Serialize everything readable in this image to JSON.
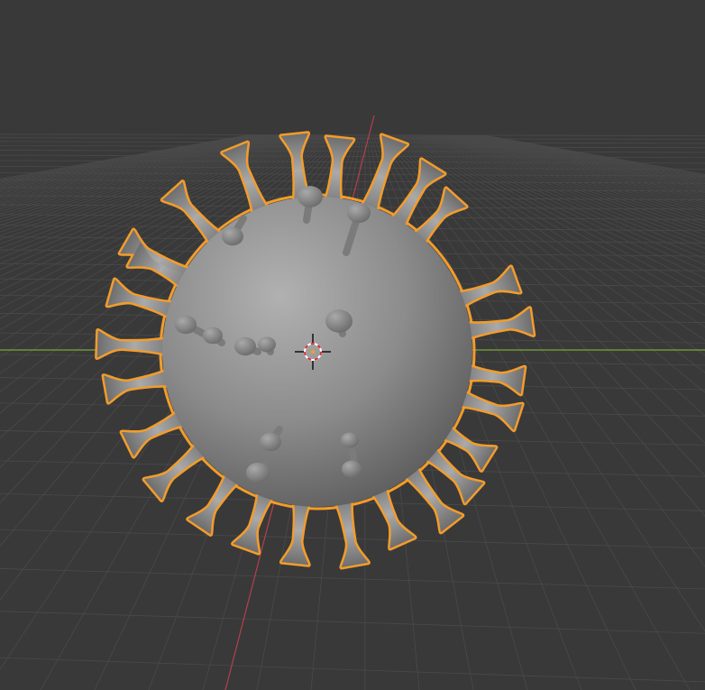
{
  "viewport": {
    "mode": "object-mode",
    "shading": "solid",
    "background_color": "#393939",
    "grid_color": "#4a4a4a",
    "x_axis_color": "#c2404f",
    "y_axis_color": "#7ca83a",
    "selection_outline_color": "#f39c2b"
  },
  "scene": {
    "selected_object": {
      "icon": "virus-mesh",
      "shape": "sphere-with-spikes",
      "mesh_color": "#8a8a8a",
      "selected": true
    },
    "cursor": {
      "icon": "3d-cursor-icon"
    }
  }
}
